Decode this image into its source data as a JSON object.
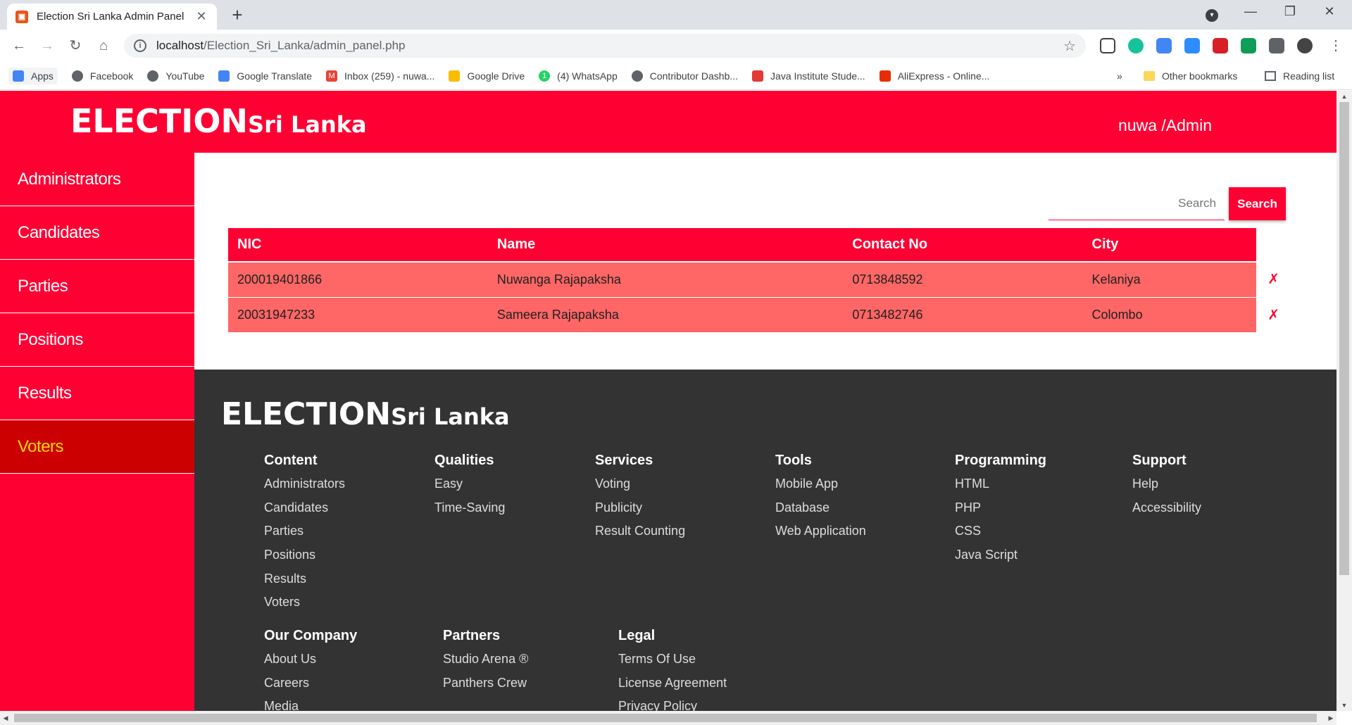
{
  "browser": {
    "tab_title": "Election Sri Lanka Admin Panel",
    "url_host": "localhost",
    "url_path": "/Election_Sri_Lanka/admin_panel.php",
    "bookmarks": [
      "Apps",
      "Facebook",
      "YouTube",
      "Google Translate",
      "Inbox (259) - nuwa...",
      "Google Drive",
      "(4) WhatsApp",
      "Contributor Dashb...",
      "Java Institute Stude...",
      "AliExpress - Online..."
    ],
    "other_bookmarks": "Other bookmarks",
    "reading_list": "Reading list",
    "overflow": "»"
  },
  "header": {
    "logo_big": "ELECTION",
    "logo_small": "Sri Lanka",
    "user": "nuwa /Admin"
  },
  "sidebar": {
    "items": [
      {
        "label": "Administrators"
      },
      {
        "label": "Candidates"
      },
      {
        "label": "Parties"
      },
      {
        "label": "Positions"
      },
      {
        "label": "Results"
      },
      {
        "label": "Voters",
        "active": true
      }
    ]
  },
  "search": {
    "placeholder": "Search",
    "button": "Search"
  },
  "table": {
    "columns": [
      "NIC",
      "Name",
      "Contact No",
      "City"
    ],
    "rows": [
      {
        "nic": "200019401866",
        "name": "Nuwanga Rajapaksha",
        "contact": "0713848592",
        "city": "Kelaniya",
        "delete": "✗"
      },
      {
        "nic": "20031947233",
        "name": "Sameera Rajapaksha",
        "contact": "0713482746",
        "city": "Colombo",
        "delete": "✗"
      }
    ]
  },
  "footer": {
    "logo_big": "ELECTION",
    "logo_small": "Sri Lanka",
    "columns": [
      {
        "title": "Content",
        "links": [
          "Administrators",
          "Candidates",
          "Parties",
          "Positions",
          "Results",
          "Voters"
        ]
      },
      {
        "title": "Qualities",
        "links": [
          "Easy",
          "Time-Saving"
        ]
      },
      {
        "title": "Services",
        "links": [
          "Voting",
          "Publicity",
          "Result Counting"
        ]
      },
      {
        "title": "Tools",
        "links": [
          "Mobile App",
          "Database",
          "Web Application"
        ]
      },
      {
        "title": "Programming",
        "links": [
          "HTML",
          "PHP",
          "CSS",
          "Java Script"
        ]
      },
      {
        "title": "Support",
        "links": [
          "Help",
          "Accessibility"
        ]
      },
      {
        "title": "Our Company",
        "links": [
          "About Us",
          "Careers",
          "Media"
        ]
      },
      {
        "title": "Partners",
        "links": [
          "Studio Arena ®",
          "Panthers Crew"
        ]
      },
      {
        "title": "Legal",
        "links": [
          "Terms Of Use",
          "License Agreement",
          "Privacy Policy"
        ]
      }
    ]
  },
  "colors": {
    "primary": "#ff0033",
    "row": "#ff6666",
    "active": "#cc0000",
    "active_text": "#ffd700",
    "footer": "#333333"
  }
}
